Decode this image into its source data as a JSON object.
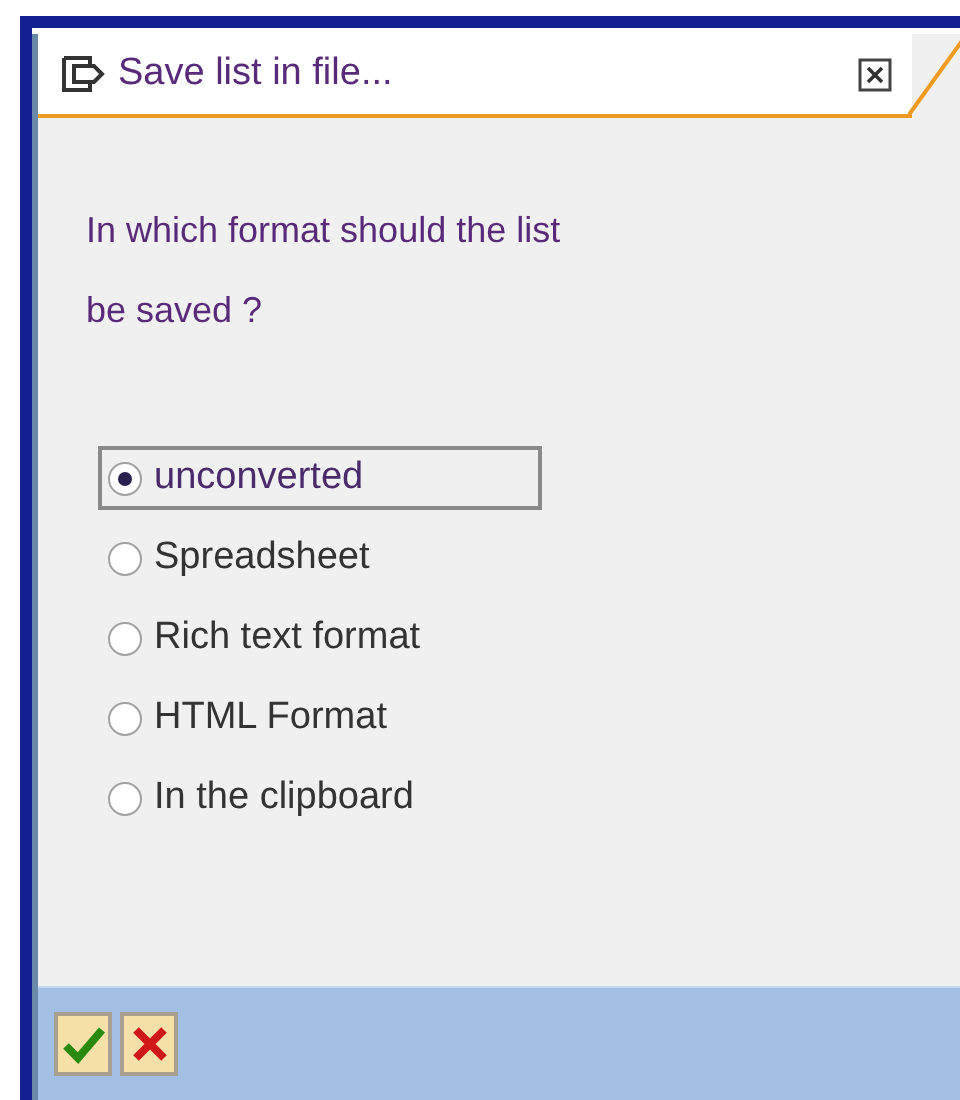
{
  "window": {
    "title": "Save list in file..."
  },
  "question": [
    "In which format should the list",
    "be saved ?"
  ],
  "options": [
    {
      "label": "unconverted",
      "selected": true
    },
    {
      "label": "Spreadsheet",
      "selected": false
    },
    {
      "label": "Rich text format",
      "selected": false
    },
    {
      "label": "HTML Format",
      "selected": false
    },
    {
      "label": "In the clipboard",
      "selected": false
    }
  ],
  "buttons": [
    {
      "kind": "confirm"
    },
    {
      "kind": "cancel"
    }
  ]
}
